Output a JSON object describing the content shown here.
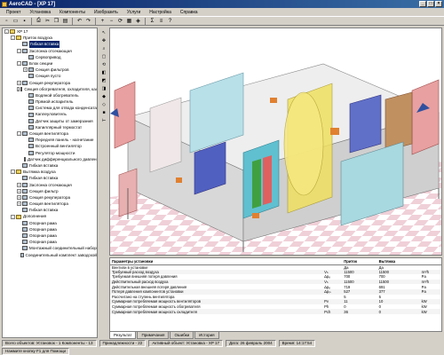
{
  "window": {
    "title": "AeroCAD - [XP 17]"
  },
  "menu": [
    "Проект",
    "Установка",
    "Компоненты",
    "Изобразить",
    "Услуги",
    "Настройка",
    "Справка"
  ],
  "tree": [
    {
      "label": "XP 17",
      "lvl": 0,
      "exp": "-",
      "ico": "fold"
    },
    {
      "label": "Приток воздуха",
      "lvl": 1,
      "exp": "-",
      "ico": "fold"
    },
    {
      "label": "Гибкая вставка",
      "lvl": 2,
      "exp": "",
      "ico": "comp",
      "sel": true
    },
    {
      "label": "Заслонка отсекающая",
      "lvl": 2,
      "exp": "-",
      "ico": "comp"
    },
    {
      "label": "Сервопривод",
      "lvl": 3,
      "exp": "",
      "ico": "comp"
    },
    {
      "label": "Блок секции",
      "lvl": 2,
      "exp": "-",
      "ico": "comp"
    },
    {
      "label": "Секция фильтров",
      "lvl": 3,
      "exp": "+",
      "ico": "comp"
    },
    {
      "label": "Секция пусто",
      "lvl": 3,
      "exp": "",
      "ico": "comp"
    },
    {
      "label": "Секция рекуператора",
      "lvl": 2,
      "exp": "+",
      "ico": "comp"
    },
    {
      "label": "Секция обогревателя, охладителя, калорифера",
      "lvl": 2,
      "exp": "-",
      "ico": "comp"
    },
    {
      "label": "Водяной обогреватель",
      "lvl": 3,
      "exp": "",
      "ico": "comp"
    },
    {
      "label": "Прямой испаритель",
      "lvl": 3,
      "exp": "",
      "ico": "comp"
    },
    {
      "label": "Система для отвода конденсата",
      "lvl": 3,
      "exp": "",
      "ico": "comp"
    },
    {
      "label": "Каплеуловитель",
      "lvl": 3,
      "exp": "",
      "ico": "comp"
    },
    {
      "label": "Датчик защиты от замерзания",
      "lvl": 3,
      "exp": "",
      "ico": "comp"
    },
    {
      "label": "Капиллярный термостат",
      "lvl": 3,
      "exp": "",
      "ico": "comp"
    },
    {
      "label": "Секция вентилятора",
      "lvl": 2,
      "exp": "-",
      "ico": "comp"
    },
    {
      "label": "Передняя панель - нагнетание",
      "lvl": 3,
      "exp": "",
      "ico": "comp"
    },
    {
      "label": "Встроенный вентилятор",
      "lvl": 3,
      "exp": "",
      "ico": "comp"
    },
    {
      "label": "Регулятор мощности",
      "lvl": 3,
      "exp": "",
      "ico": "comp"
    },
    {
      "label": "Датчик дифференциального давления",
      "lvl": 3,
      "exp": "",
      "ico": "comp"
    },
    {
      "label": "Гибкая вставка",
      "lvl": 2,
      "exp": "",
      "ico": "comp"
    },
    {
      "label": "Вытяжка воздуха",
      "lvl": 1,
      "exp": "-",
      "ico": "fold"
    },
    {
      "label": "Гибкая вставка",
      "lvl": 2,
      "exp": "",
      "ico": "comp"
    },
    {
      "label": "Заслонка отсекающая",
      "lvl": 2,
      "exp": "+",
      "ico": "comp"
    },
    {
      "label": "Секция фильтр",
      "lvl": 2,
      "exp": "+",
      "ico": "comp"
    },
    {
      "label": "Секция рекуператора",
      "lvl": 2,
      "exp": "+",
      "ico": "comp"
    },
    {
      "label": "Секция вентилятора",
      "lvl": 2,
      "exp": "+",
      "ico": "comp"
    },
    {
      "label": "Гибкая вставка",
      "lvl": 2,
      "exp": "",
      "ico": "comp"
    },
    {
      "label": "Дополнения",
      "lvl": 1,
      "exp": "-",
      "ico": "fold"
    },
    {
      "label": "Опорная рама",
      "lvl": 2,
      "exp": "",
      "ico": "comp"
    },
    {
      "label": "Опорная рама",
      "lvl": 2,
      "exp": "",
      "ico": "comp"
    },
    {
      "label": "Опорная рама",
      "lvl": 2,
      "exp": "",
      "ico": "comp"
    },
    {
      "label": "Опорная рама",
      "lvl": 2,
      "exp": "",
      "ico": "comp"
    },
    {
      "label": "Монтажный соединительный набор",
      "lvl": 2,
      "exp": "",
      "ico": "comp"
    },
    {
      "label": "Соединительный комплект заводской",
      "lvl": 2,
      "exp": "",
      "ico": "comp"
    }
  ],
  "params": {
    "headers": [
      "Параметры установки",
      "",
      "Приток",
      "Вытяжка",
      ""
    ],
    "rows": [
      [
        "Вентили в установке",
        "",
        "Да",
        "Да",
        ""
      ],
      [
        "Требуемый расход воздуха",
        "Vₕ",
        "11500",
        "11500",
        "m³/h"
      ],
      [
        "Требуемая внешняя потеря давления",
        "Δpₑ",
        "700",
        "700",
        "Pa"
      ],
      [
        "Действительный расход воздуха",
        "Vₕ",
        "11500",
        "11500",
        "m³/h"
      ],
      [
        "Действительная внешняя потеря давления",
        "Δpₑ",
        "719",
        "691",
        "Pa"
      ],
      [
        "Потеря давления компонентов установки",
        "Δpᵢₙ",
        "527",
        "377",
        "Pa"
      ],
      [
        "Рассчитано на ступень вентилятора",
        "",
        "5",
        "5",
        ""
      ],
      [
        "Суммарная потребляемая мощность вентиляторов",
        "Pv",
        "11",
        "10",
        "kW"
      ],
      [
        "Суммарная потребляемая мощность обогревателя",
        "Ph",
        "0",
        "0",
        "kW"
      ],
      [
        "Суммарная потребляемая мощность охладителя",
        "Pch",
        "36",
        "0",
        "kW"
      ]
    ]
  },
  "tabs": [
    "Результат",
    "Примечания",
    "Ошибки",
    "История"
  ],
  "status1": [
    "Всего объектов: Установок - 1  Компоненты - 13",
    "Принадлежности - 22",
    "Активный объект: Установка - XP 17",
    "Дата: 26 февраль 2004",
    "Время: 14:17:54"
  ],
  "status2": [
    "Нажмите кнопку F1 для Помощи"
  ]
}
